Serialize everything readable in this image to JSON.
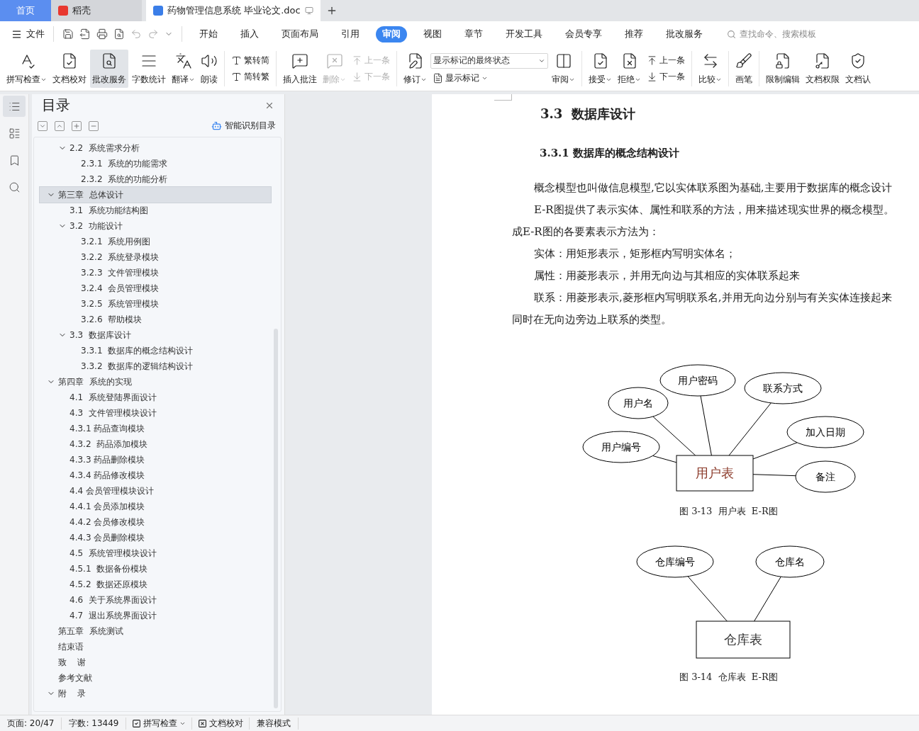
{
  "tabs": [
    {
      "label": "首页",
      "kind": "home",
      "selected": false
    },
    {
      "label": "稻壳",
      "kind": "docer",
      "selected": false
    },
    {
      "label": "药物管理信息系统 毕业论文.doc",
      "kind": "document",
      "selected": true
    }
  ],
  "menu": {
    "file": "文件",
    "ribbon_tabs": [
      {
        "label": "开始",
        "selected": false
      },
      {
        "label": "插入",
        "selected": false
      },
      {
        "label": "页面布局",
        "selected": false
      },
      {
        "label": "引用",
        "selected": false
      },
      {
        "label": "审阅",
        "selected": true
      },
      {
        "label": "视图",
        "selected": false
      },
      {
        "label": "章节",
        "selected": false
      },
      {
        "label": "开发工具",
        "selected": false
      },
      {
        "label": "会员专享",
        "selected": false
      },
      {
        "label": "推荐",
        "selected": false
      },
      {
        "label": "批改服务",
        "selected": false
      }
    ],
    "search": {
      "placeholder": "查找命令、搜索模板"
    }
  },
  "ribbon": {
    "groups": [
      {
        "items": [
          {
            "kind": "large",
            "label": "拼写检查",
            "dropdown": true,
            "disabled": false,
            "selected": false
          },
          {
            "kind": "large",
            "label": "文档校对",
            "dropdown": false,
            "disabled": false,
            "selected": false
          },
          {
            "kind": "large",
            "label": "批改服务",
            "dropdown": false,
            "disabled": false,
            "selected": true
          },
          {
            "kind": "large",
            "label": "字数统计",
            "dropdown": false,
            "disabled": false,
            "selected": false
          },
          {
            "kind": "large",
            "label": "翻译",
            "dropdown": true,
            "disabled": false,
            "selected": false
          },
          {
            "kind": "large",
            "label": "朗读",
            "dropdown": false,
            "disabled": false,
            "selected": false
          }
        ]
      },
      {
        "items": [
          {
            "kind": "stack",
            "items": [
              {
                "kind": "small",
                "label": "繁转简",
                "dropdown": false,
                "disabled": false
              },
              {
                "kind": "small",
                "label": "简转繁",
                "dropdown": false,
                "disabled": false
              }
            ]
          }
        ]
      },
      {
        "items": [
          {
            "kind": "large",
            "label": "插入批注",
            "dropdown": false,
            "disabled": false,
            "selected": false
          },
          {
            "kind": "large",
            "label": "删除",
            "dropdown": true,
            "disabled": true,
            "selected": false
          },
          {
            "kind": "stack",
            "items": [
              {
                "kind": "small",
                "label": "上一条",
                "dropdown": false,
                "disabled": true
              },
              {
                "kind": "small",
                "label": "下一条",
                "dropdown": false,
                "disabled": true
              }
            ]
          }
        ]
      },
      {
        "items": [
          {
            "kind": "large",
            "label": "修订",
            "dropdown": true,
            "disabled": false,
            "selected": false
          },
          {
            "kind": "stack",
            "items": [
              {
                "kind": "select",
                "value": "显示标记的最终状态"
              },
              {
                "kind": "small",
                "label": "显示标记",
                "dropdown": true,
                "disabled": false
              }
            ]
          },
          {
            "kind": "large",
            "label": "审阅",
            "dropdown": true,
            "disabled": false,
            "selected": false
          }
        ]
      },
      {
        "items": [
          {
            "kind": "large",
            "label": "接受",
            "dropdown": true,
            "disabled": false,
            "selected": false
          },
          {
            "kind": "large",
            "label": "拒绝",
            "dropdown": true,
            "disabled": false,
            "selected": false
          },
          {
            "kind": "stack",
            "items": [
              {
                "kind": "small",
                "label": "上一条",
                "dropdown": false,
                "disabled": false
              },
              {
                "kind": "small",
                "label": "下一条",
                "dropdown": false,
                "disabled": false
              }
            ]
          }
        ]
      },
      {
        "items": [
          {
            "kind": "large",
            "label": "比较",
            "dropdown": true,
            "disabled": false,
            "selected": false
          }
        ]
      },
      {
        "items": [
          {
            "kind": "large",
            "label": "画笔",
            "dropdown": false,
            "disabled": false,
            "selected": false
          }
        ]
      },
      {
        "items": [
          {
            "kind": "large",
            "label": "限制编辑",
            "dropdown": false,
            "disabled": false,
            "selected": false
          },
          {
            "kind": "large",
            "label": "文档权限",
            "dropdown": false,
            "disabled": false,
            "selected": false
          },
          {
            "kind": "large",
            "label": "文档认",
            "dropdown": false,
            "disabled": false,
            "selected": false
          }
        ]
      }
    ]
  },
  "rail": [
    {
      "selected": true
    },
    {
      "selected": false
    },
    {
      "selected": false
    },
    {
      "selected": false
    }
  ],
  "sidebar": {
    "title": "目录",
    "smart_button": "智能识别目录",
    "toc_continued": [
      {
        "label": "2.2  系统需求分析",
        "expanded": true,
        "selected": false,
        "children": [
          {
            "label": "2.3.1  系统的功能需求",
            "selected": false
          },
          {
            "label": "2.3.2  系统的功能分析",
            "selected": false
          }
        ]
      }
    ],
    "toc": [
      {
        "label": "第三章  总体设计",
        "expanded": true,
        "selected": true,
        "children": [
          {
            "label": "3.1  系统功能结构图",
            "selected": false
          },
          {
            "label": "3.2  功能设计",
            "expanded": true,
            "selected": false,
            "children": [
              {
                "label": "3.2.1  系统用例图",
                "selected": false
              },
              {
                "label": "3.2.2  系统登录模块",
                "selected": false
              },
              {
                "label": "3.2.3  文件管理模块",
                "selected": false
              },
              {
                "label": "3.2.4  会员管理模块",
                "selected": false
              },
              {
                "label": "3.2.5  系统管理模块",
                "selected": false
              },
              {
                "label": "3.2.6  帮助模块",
                "selected": false
              }
            ]
          },
          {
            "label": "3.3  数据库设计",
            "expanded": true,
            "selected": false,
            "children": [
              {
                "label": "3.3.1  数据库的概念结构设计",
                "selected": false
              },
              {
                "label": "3.3.2  数据库的逻辑结构设计",
                "selected": false
              }
            ]
          }
        ]
      },
      {
        "label": "第四章  系统的实现",
        "expanded": true,
        "selected": false,
        "children": [
          {
            "label": "4.1  系统登陆界面设计",
            "selected": false
          },
          {
            "label": "4.3  文件管理模块设计",
            "selected": false
          },
          {
            "label": "4.3.1 药品查询模块",
            "selected": false
          },
          {
            "label": "4.3.2  药品添加模块",
            "selected": false
          },
          {
            "label": "4.3.3 药品删除模块",
            "selected": false
          },
          {
            "label": "4.3.4 药品修改模块",
            "selected": false
          },
          {
            "label": "4.4 会员管理模块设计",
            "selected": false
          },
          {
            "label": "4.4.1 会员添加模块",
            "selected": false
          },
          {
            "label": "4.4.2 会员修改模块",
            "selected": false
          },
          {
            "label": "4.4.3 会员删除模块",
            "selected": false
          },
          {
            "label": "4.5  系统管理模块设计",
            "selected": false
          },
          {
            "label": "4.5.1  数据备份模块",
            "selected": false
          },
          {
            "label": "4.5.2  数据还原模块",
            "selected": false
          },
          {
            "label": "4.6  关于系统界面设计",
            "selected": false
          },
          {
            "label": "4.7  退出系统界面设计",
            "selected": false
          }
        ]
      },
      {
        "label": "第五章  系统测试",
        "selected": false
      },
      {
        "label": "结束语",
        "selected": false
      },
      {
        "label": "致    谢",
        "selected": false
      },
      {
        "label": "参考文献",
        "selected": false
      },
      {
        "label": "附    录",
        "expanded": true,
        "selected": false
      }
    ]
  },
  "document": {
    "heading": "3.3  数据库设计",
    "subheading": "3.3.1 数据库的概念结构设计",
    "paragraphs": [
      {
        "text": "概念模型也叫做信息模型,它以实体联系图为基础,主要用于数据库的概念设计",
        "indent": true
      },
      {
        "text": "E-R图提供了表示实体、属性和联系的方法，用来描述现实世界的概念模型。",
        "indent": true
      },
      {
        "text": "成E-R图的各要素表示方法为：",
        "indent": false
      },
      {
        "text": "实体：用矩形表示，矩形框内写明实体名；",
        "indent": true
      },
      {
        "text": "属性：用菱形表示，并用无向边与其相应的实体联系起来",
        "indent": true
      },
      {
        "text": "联系：用菱形表示,菱形框内写明联系名,并用无向边分别与有关实体连接起来",
        "indent": true
      },
      {
        "text": "同时在无向边旁边上联系的类型。",
        "indent": false
      }
    ],
    "figures": [
      {
        "entity": "用户表",
        "attributes": [
          "用户名",
          "用户密码",
          "联系方式",
          "加入日期",
          "用户编号",
          "备注"
        ],
        "caption": "图 3-13  用户表  E-R图"
      },
      {
        "entity": "仓库表",
        "attributes": [
          "仓库编号",
          "仓库名"
        ],
        "caption": "图 3-14  仓库表  E-R图"
      }
    ]
  },
  "status_bar": [
    {
      "kind": "text",
      "label": "页面: 20/47"
    },
    {
      "kind": "text",
      "label": "字数: 13449"
    },
    {
      "kind": "button",
      "label": "拼写检查",
      "dropdown": true
    },
    {
      "kind": "button",
      "label": "文档校对",
      "dropdown": false
    },
    {
      "kind": "text",
      "label": "兼容模式"
    }
  ]
}
